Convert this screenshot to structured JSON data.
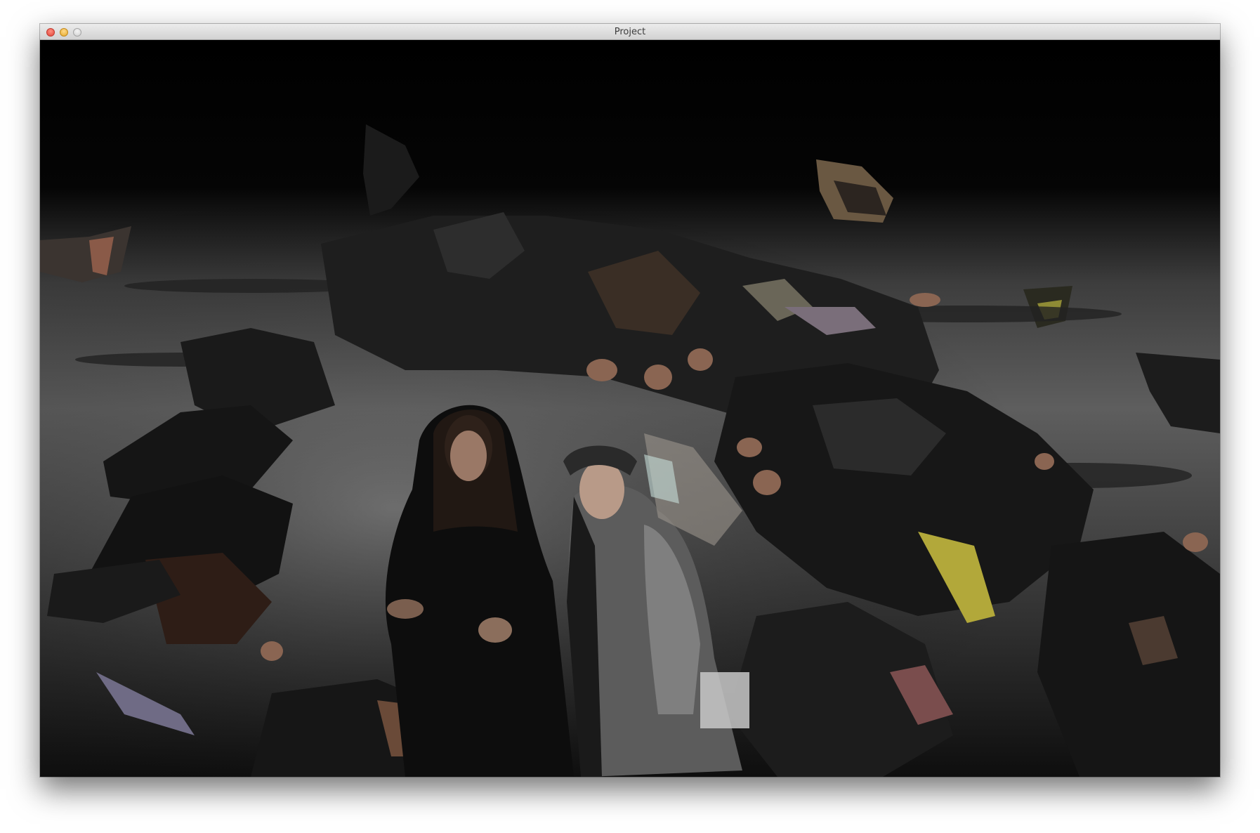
{
  "window": {
    "title": "Project"
  },
  "colors": {
    "titlebar_top": "#ececec",
    "titlebar_bottom": "#d2d2d2",
    "close": "#e0443a",
    "minimize": "#e5a929",
    "zoom": "#cfcfcf",
    "background": "#000000",
    "floor": "#5a5a5a"
  },
  "scene": {
    "icon": "3d-point-cloud-render",
    "description_visible": false
  }
}
